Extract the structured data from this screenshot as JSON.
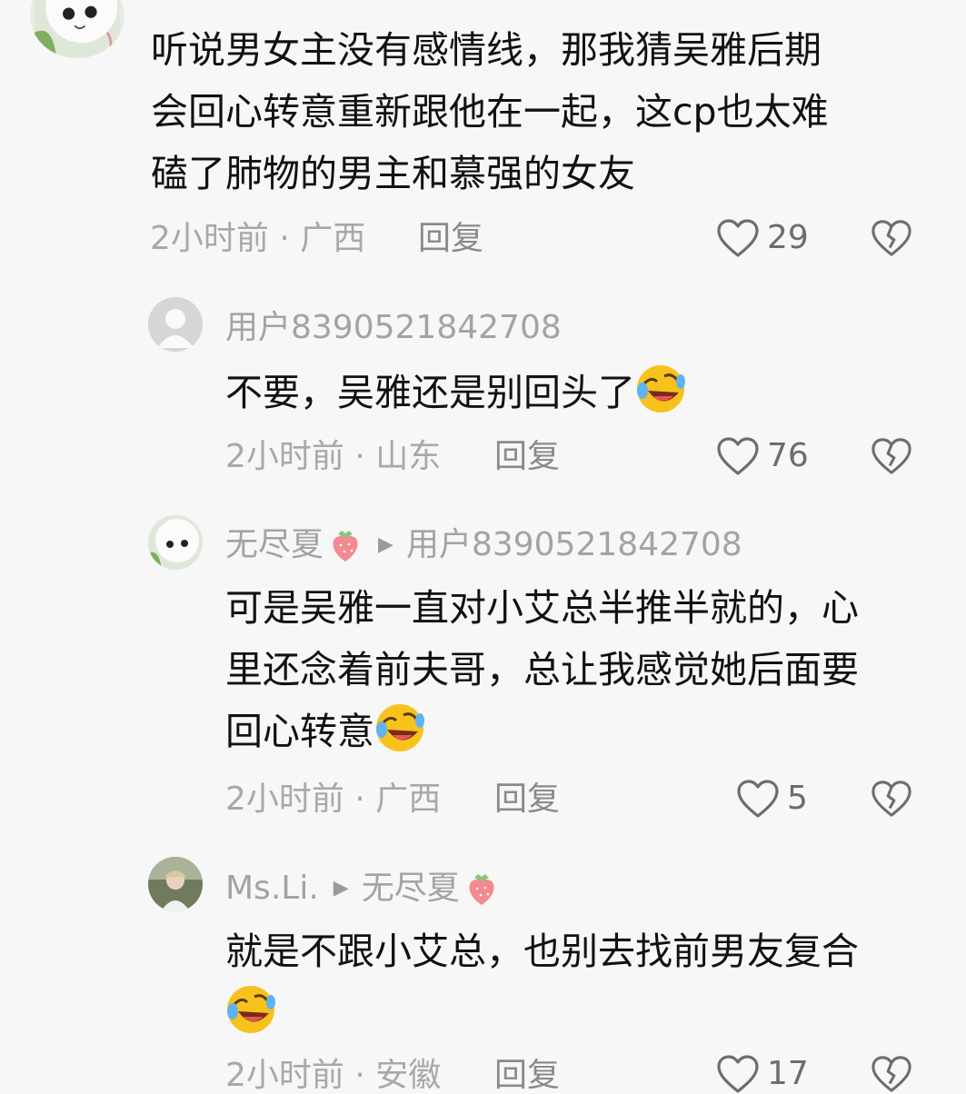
{
  "comments": [
    {
      "lines": [
        "听说男女主没有感情线，那我猜吴雅后期",
        "会回心转意重新跟他在一起，这cp也太难",
        "磕了肺物的男主和慕强的女友"
      ],
      "meta": "2小时前 · 广西",
      "reply_label": "回复",
      "likes": "29"
    },
    {
      "user": "用户8390521842708",
      "lines": [
        "不要，吴雅还是别回头了"
      ],
      "meta": "2小时前 · 山东",
      "reply_label": "回复",
      "likes": "76"
    },
    {
      "user": "无尽夏",
      "reply_to": "用户8390521842708",
      "lines": [
        "可是吴雅一直对小艾总半推半就的，心",
        "里还念着前夫哥，总让我感觉她后面要",
        "回心转意"
      ],
      "meta": "2小时前 · 广西",
      "reply_label": "回复",
      "likes": "5"
    },
    {
      "user": "Ms.Li.",
      "reply_to": "无尽夏",
      "lines": [
        "就是不跟小艾总，也别去找前男友复合"
      ],
      "meta": "2小时前 · 安徽",
      "reply_label": "回复",
      "likes": "17"
    }
  ],
  "icons": {
    "like": "heart-outline-icon",
    "dislike": "broken-heart-icon",
    "emoji": "rofl-emoji",
    "strawberry": "strawberry-emoji",
    "reply_arrow": "play-triangle-icon"
  },
  "colors": {
    "background": "#f7f7f7",
    "text": "#111111",
    "muted": "#a8a8a8",
    "icon": "#6d6d6d"
  }
}
